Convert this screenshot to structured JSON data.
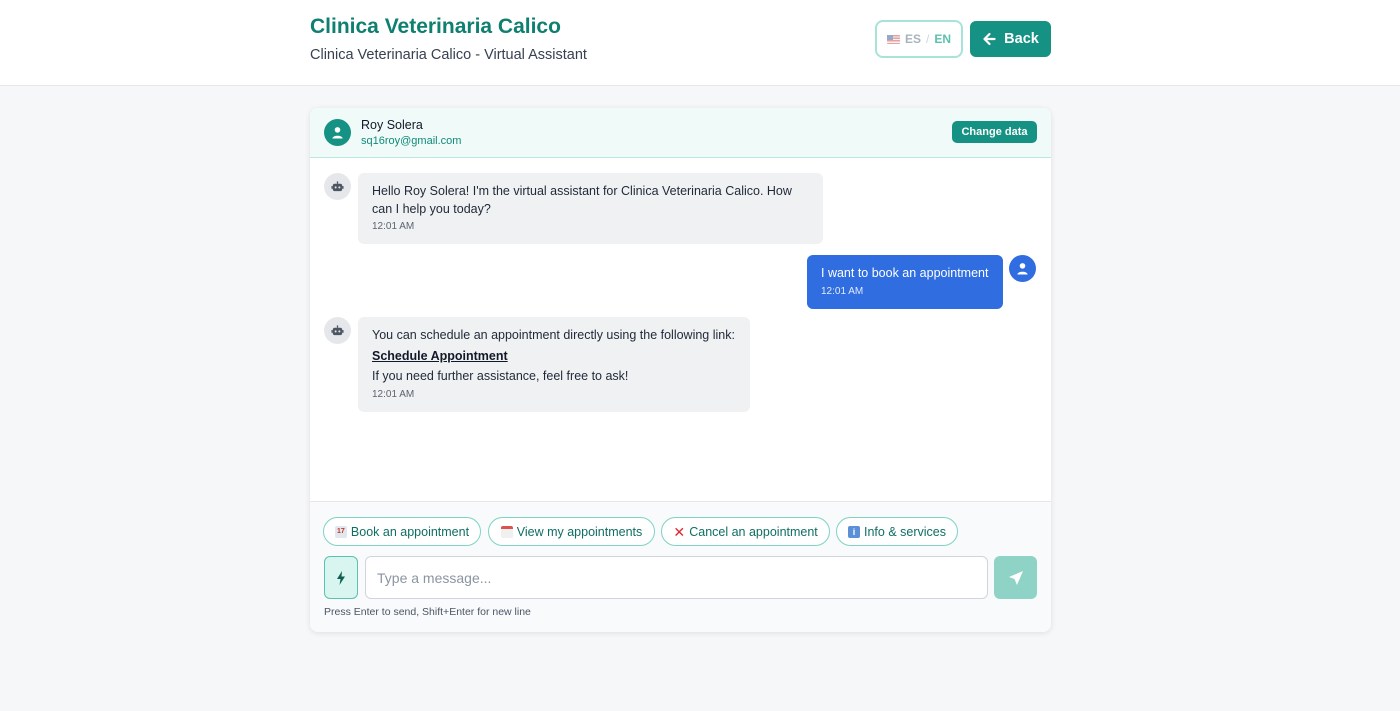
{
  "header": {
    "title": "Clinica Veterinaria Calico",
    "subtitle": "Clinica Veterinaria Calico - Virtual Assistant",
    "lang_es": "ES",
    "lang_sep": "/",
    "lang_en": "EN",
    "back_label": "Back"
  },
  "user": {
    "name": "Roy Solera",
    "email": "sq16roy@gmail.com",
    "change_label": "Change data"
  },
  "messages": [
    {
      "sender": "bot",
      "lines": [
        "Hello Roy Solera! I'm the virtual assistant for Clinica Veterinaria Calico. How can I help you today?"
      ],
      "time": "12:01 AM"
    },
    {
      "sender": "user",
      "lines": [
        "I want to book an appointment"
      ],
      "time": "12:01 AM"
    },
    {
      "sender": "bot",
      "lines": [
        "You can schedule an appointment directly using the following link:",
        "Schedule Appointment",
        "If you need further assistance, feel free to ask!"
      ],
      "time": "12:01 AM"
    }
  ],
  "quick_actions": [
    {
      "icon": "calendar-icon",
      "label": "Book an appointment"
    },
    {
      "icon": "tear-off-calendar-icon",
      "label": "View my appointments"
    },
    {
      "icon": "red-x-icon",
      "label": "Cancel an appointment"
    },
    {
      "icon": "info-icon",
      "label": "Info & services"
    }
  ],
  "composer": {
    "placeholder": "Type a message...",
    "hint": "Press Enter to send, Shift+Enter for new line"
  },
  "colors": {
    "brand": "#0f7f70",
    "accent": "#159283",
    "user_bubble": "#2f6de0",
    "bot_bubble": "#f0f1f3"
  }
}
